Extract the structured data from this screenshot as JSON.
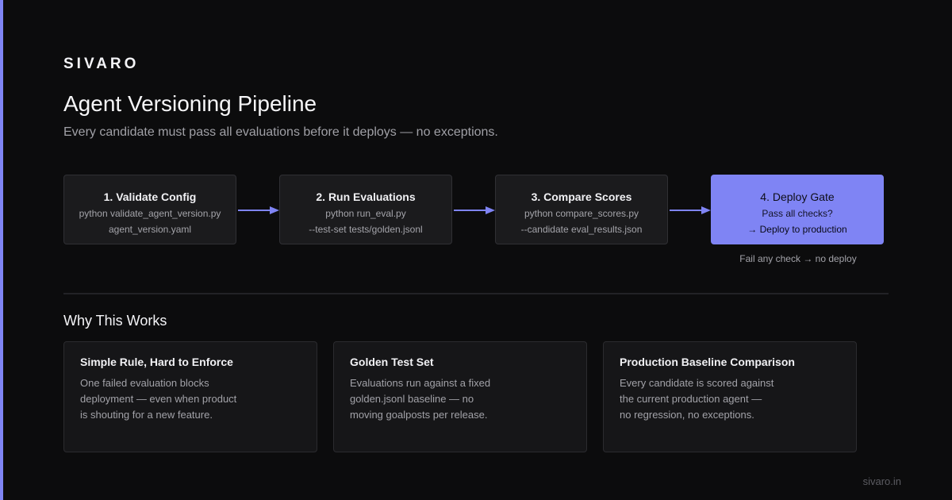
{
  "brand": "SIVARO",
  "header": {
    "title": "Agent Versioning Pipeline",
    "subtitle": "Every candidate must pass all evaluations before it deploys — no exceptions."
  },
  "pipeline": {
    "steps": [
      {
        "title": "1. Validate Config",
        "line1": "python validate_agent_version.py",
        "line2": "agent_version.yaml"
      },
      {
        "title": "2. Run Evaluations",
        "line1": "python run_eval.py",
        "line2": "--test-set tests/golden.jsonl"
      },
      {
        "title": "3. Compare Scores",
        "line1": "python compare_scores.py",
        "line2": "--candidate eval_results.json"
      },
      {
        "title": "4. Deploy Gate",
        "line1": "Pass all checks?",
        "line2": "→ Deploy to production"
      }
    ],
    "gate_note": "Fail any check → no deploy"
  },
  "why": {
    "title": "Why This Works",
    "cards": [
      {
        "title": "Simple Rule, Hard to Enforce",
        "lines": [
          "One failed evaluation blocks",
          "deployment — even when product",
          "is shouting for a new feature."
        ]
      },
      {
        "title": "Golden Test Set",
        "lines": [
          "Evaluations run against a fixed",
          "golden.jsonl baseline — no",
          "moving goalposts per release."
        ]
      },
      {
        "title": "Production Baseline Comparison",
        "lines": [
          "Every candidate is scored against",
          "the current production agent —",
          "no regression, no exceptions."
        ]
      }
    ]
  },
  "footer": "sivaro.in",
  "colors": {
    "accent": "#7f84f4",
    "background": "#0c0c0d",
    "card": "#1b1b1d"
  }
}
